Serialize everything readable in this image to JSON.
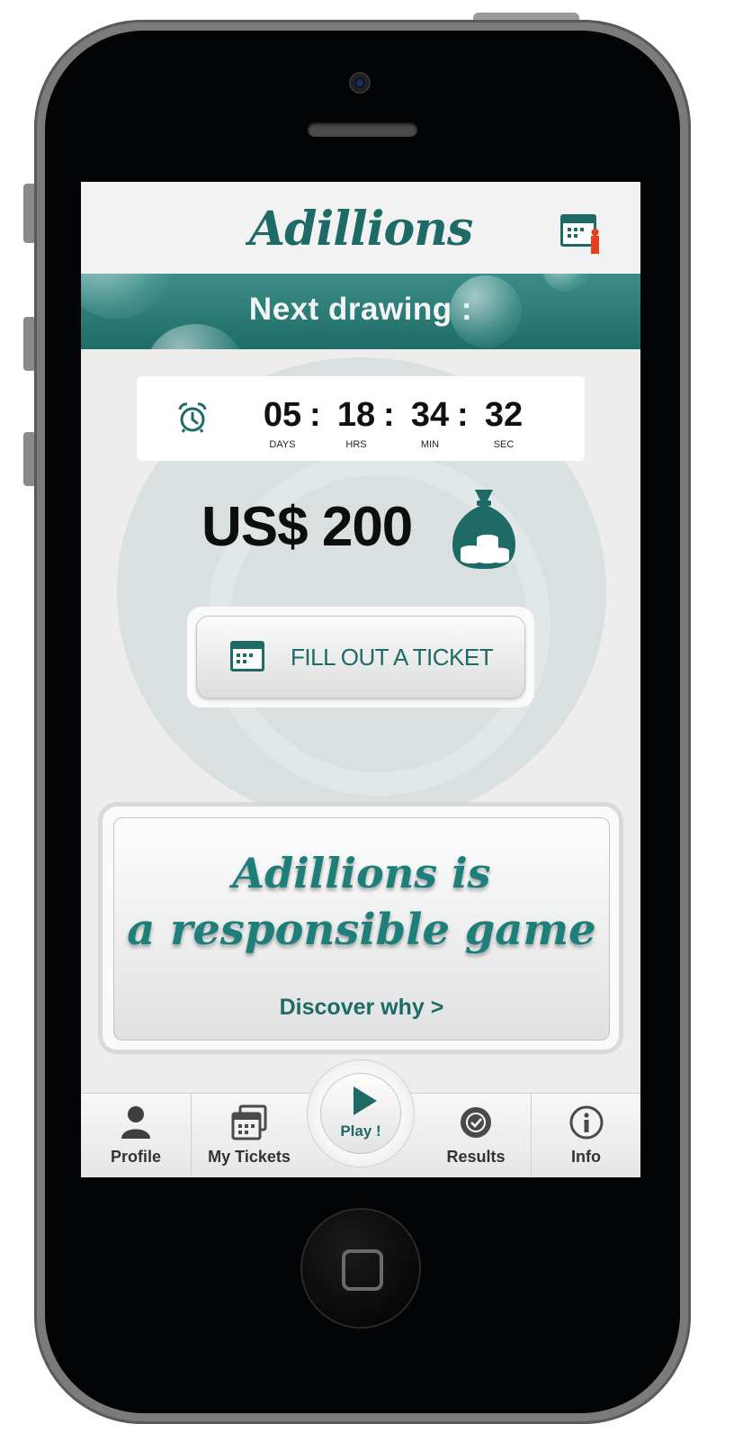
{
  "app": {
    "title": "Adillions"
  },
  "banner": {
    "text": "Next drawing :"
  },
  "countdown": {
    "days": "05",
    "hours": "18",
    "minutes": "34",
    "seconds": "32",
    "days_label": "DAYS",
    "hours_label": "HRS",
    "minutes_label": "MIN",
    "seconds_label": "SEC",
    "separator": ":"
  },
  "prize": {
    "amount": "US$ 200"
  },
  "fill_ticket": {
    "label": "FILL OUT A TICKET"
  },
  "responsible": {
    "line1": "Adillions is",
    "line2": "a responsible game",
    "link": "Discover why >"
  },
  "tabs": {
    "profile": "Profile",
    "my_tickets": "My Tickets",
    "play": "Play !",
    "results": "Results",
    "info": "Info"
  },
  "colors": {
    "accent": "#1d6a66",
    "info_red": "#e2401f"
  },
  "icons": [
    "calendar-info-icon",
    "alarm-clock-icon",
    "money-bag-icon",
    "calendar-icon",
    "user-icon",
    "tickets-icon",
    "play-icon",
    "results-check-icon",
    "info-icon"
  ]
}
